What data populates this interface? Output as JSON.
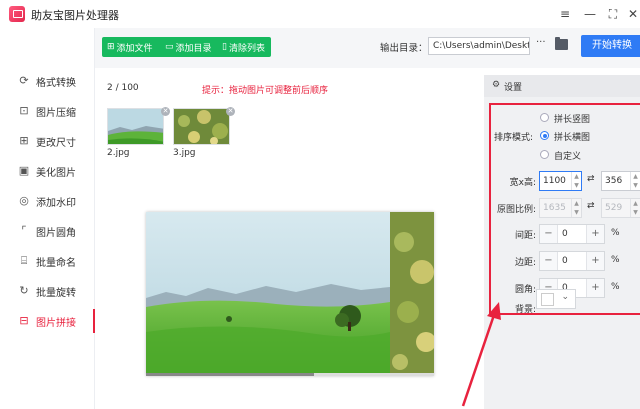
{
  "app": {
    "title": "助友宝图片处理器"
  },
  "window_controls": {
    "menu": "≡",
    "minimize": "—",
    "maximize": "⛶",
    "close": "✕"
  },
  "sidebar": {
    "items": [
      {
        "label": "格式转换",
        "icon": "format-convert-icon"
      },
      {
        "label": "图片压缩",
        "icon": "compress-icon"
      },
      {
        "label": "更改尺寸",
        "icon": "resize-icon"
      },
      {
        "label": "美化图片",
        "icon": "beautify-icon"
      },
      {
        "label": "添加水印",
        "icon": "watermark-icon"
      },
      {
        "label": "图片圆角",
        "icon": "round-corner-icon"
      },
      {
        "label": "批量命名",
        "icon": "rename-icon"
      },
      {
        "label": "批量旋转",
        "icon": "rotate-icon"
      },
      {
        "label": "图片拼接",
        "icon": "stitch-icon",
        "active": true
      }
    ]
  },
  "toolbar": {
    "add_file": "添加文件",
    "add_folder": "添加目录",
    "clear_list": "清除列表",
    "output_label": "输出目录：",
    "output_path": "C:\\Users\\admin\\Desktop",
    "more": "···",
    "start": "开始转换"
  },
  "main": {
    "count": "2 / 100",
    "hint": "提示：拖动图片可调整前后顺序",
    "thumbs": [
      {
        "name": "2.jpg"
      },
      {
        "name": "3.jpg"
      }
    ]
  },
  "settings": {
    "title": "设置",
    "order_label": "排序模式:",
    "modes": [
      "拼长竖图",
      "拼长横图",
      "自定义"
    ],
    "selected_mode": "拼长横图",
    "size_label": "宽x高:",
    "width": "1100",
    "height": "356",
    "ratio_label": "原图比例:",
    "ratio_w": "1635",
    "ratio_h": "529",
    "gap_label": "间距:",
    "gap": "0",
    "margin_label": "边距:",
    "margin": "0",
    "radius_label": "圆角:",
    "radius": "0",
    "bg_label": "背景:",
    "percent": "%",
    "background_color": "#ffffff"
  },
  "colors": {
    "accent_red": "#e8223e",
    "green_btn": "#17b95e",
    "blue_btn": "#2f7bf5"
  }
}
